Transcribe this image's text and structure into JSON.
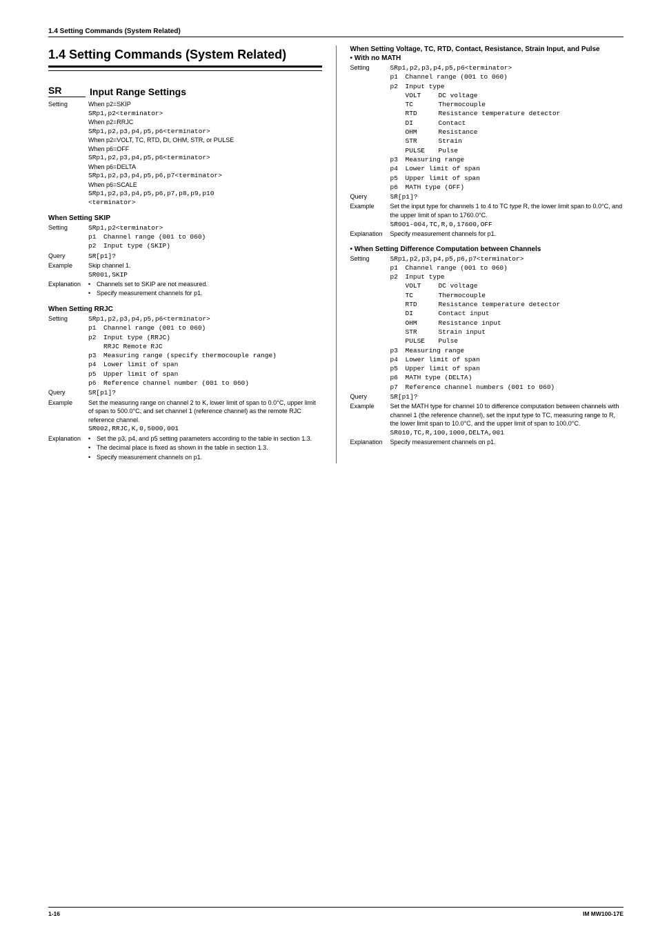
{
  "headerSection": "1.4  Setting Commands (System Related)",
  "mainHeading": "1.4   Setting Commands (System Related)",
  "sr": {
    "label": "SR",
    "title": "Input Range Settings"
  },
  "settingLabel": "Setting",
  "queryLabel": "Query",
  "exampleLabel": "Example",
  "explanationLabel": "Explanation",
  "leftSettings": {
    "l1": "When p2=SKIP",
    "l2": "SRp1,p2<terminator>",
    "l3": "When p2=RRJC",
    "l4": "SRp1,p2,p3,p4,p5,p6<terminator>",
    "l5": "When p2=VOLT, TC, RTD, DI, OHM, STR, or PULSE",
    "l6": "When p6=OFF",
    "l7": "SRp1,p2,p3,p4,p5,p6<terminator>",
    "l8": "When p6=DELTA",
    "l9": "SRp1,p2,p3,p4,p5,p6,p7<terminator>",
    "l10": "When p6=SCALE",
    "l11": "SRp1,p2,p3,p4,p5,p6,p7,p8,p9,p10",
    "l12": "<terminator>"
  },
  "skip": {
    "heading": "When Setting SKIP",
    "setting": "SRp1,p2<terminator>",
    "p1": {
      "k": "p1",
      "v": "Channel range (001 to 060)"
    },
    "p2": {
      "k": "p2",
      "v": "Input type (SKIP)"
    },
    "query": "SR[p1]?",
    "exampleText": "Skip channel 1.",
    "exampleCmd": "SR001,SKIP",
    "b1": "Channels set to SKIP are not measured.",
    "b2": "Specify measurement channels for p1."
  },
  "rrjc": {
    "heading": "When Setting RRJC",
    "setting": "SRp1,p2,p3,p4,p5,p6<terminator>",
    "p1": {
      "k": "p1",
      "v": "Channel range (001 to 060)"
    },
    "p2": {
      "k": "p2",
      "v": "Input type (RRJC)"
    },
    "p2b": "RRJC Remote RJC",
    "p3": {
      "k": "p3",
      "v": "Measuring range (specify thermocouple range)"
    },
    "p4": {
      "k": "p4",
      "v": "Lower limit of span"
    },
    "p5": {
      "k": "p5",
      "v": "Upper limit of span"
    },
    "p6": {
      "k": "p6",
      "v": "Reference channel number (001 to 060)"
    },
    "query": "SR[p1]?",
    "ex1": "Set the measuring range on channel 2 to K, lower limit of span to 0.0°C, upper limit of span to 500.0°C, and set channel 1 (reference channel) as the remote RJC reference channel.",
    "exCmd": "SR002,RRJC,K,0,5000,001",
    "b1": "Set the p3, p4, and p5 setting parameters according to the table in section 1.3.",
    "b2": "The decimal place is fixed as shown in the table in section 1.3.",
    "b3": "Specify measurement channels on p1."
  },
  "right1": {
    "title": "When Setting Voltage, TC, RTD, Contact, Resistance, Strain Input, and Pulse",
    "sub": "• With no MATH",
    "setting": "SRp1,p2,p3,p4,p5,p6<terminator>",
    "p1": {
      "k": "p1",
      "v": "Channel range (001 to 060)"
    },
    "p2": {
      "k": "p2",
      "v": "Input type"
    },
    "types": {
      "t1": {
        "k": "VOLT",
        "v": "DC voltage"
      },
      "t2": {
        "k": "TC",
        "v": "Thermocouple"
      },
      "t3": {
        "k": "RTD",
        "v": "Resistance temperature detector"
      },
      "t4": {
        "k": "DI",
        "v": "Contact"
      },
      "t5": {
        "k": "OHM",
        "v": "Resistance"
      },
      "t6": {
        "k": "STR",
        "v": "Strain"
      },
      "t7": {
        "k": "PULSE",
        "v": "Pulse"
      }
    },
    "p3": {
      "k": "p3",
      "v": "Measuring range"
    },
    "p4": {
      "k": "p4",
      "v": "Lower limit of span"
    },
    "p5": {
      "k": "p5",
      "v": "Upper limit of span"
    },
    "p6": {
      "k": "p6",
      "v": "MATH type (OFF)"
    },
    "query": "SR[p1]?",
    "ex": "Set the input type for channels 1 to 4 to TC type R, the lower limit span to 0.0°C, and the upper limit of span to 1760.0°C.",
    "exCmd": "SR001-004,TC,R,0,17600,OFF",
    "expl": "Specify measurement channels for p1."
  },
  "right2": {
    "title": "• When Setting Difference Computation between Channels",
    "setting": "SRp1,p2,p3,p4,p5,p6,p7<terminator>",
    "p1": {
      "k": "p1",
      "v": "Channel range (001 to 060)"
    },
    "p2": {
      "k": "p2",
      "v": "Input type"
    },
    "types": {
      "t1": {
        "k": "VOLT",
        "v": "DC voltage"
      },
      "t2": {
        "k": "TC",
        "v": "Thermocouple"
      },
      "t3": {
        "k": "RTD",
        "v": "Resistance temperature detector"
      },
      "t4": {
        "k": "DI",
        "v": "Contact input"
      },
      "t5": {
        "k": "OHM",
        "v": "Resistance input"
      },
      "t6": {
        "k": "STR",
        "v": "Strain input"
      },
      "t7": {
        "k": "PULSE",
        "v": "Pulse"
      }
    },
    "p3": {
      "k": "p3",
      "v": "Measuring range"
    },
    "p4": {
      "k": "p4",
      "v": "Lower limit of span"
    },
    "p5": {
      "k": "p5",
      "v": "Upper limit of span"
    },
    "p6": {
      "k": "p6",
      "v": "MATH type (DELTA)"
    },
    "p7": {
      "k": "p7",
      "v": "Reference channel numbers (001 to 060)"
    },
    "query": "SR[p1]?",
    "ex": "Set the MATH type for channel 10 to difference computation between channels with channel 1 (the reference channel), set the input type to TC, measuring range to R, the lower limit span to 10.0°C, and the upper limit of span to 100.0°C.",
    "exCmd": "SR010,TC,R,100,1000,DELTA,001",
    "expl": "Specify measurement channels on p1."
  },
  "footer": {
    "page": "1-16",
    "doc": "IM MW100-17E"
  }
}
